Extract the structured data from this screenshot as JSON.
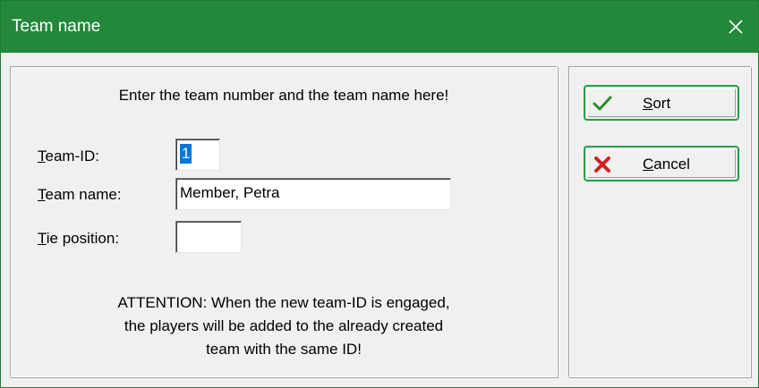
{
  "window": {
    "title": "Team name",
    "close_glyph": "✕",
    "titlebar_color": "#23883a"
  },
  "form": {
    "instruction": "Enter the team number and the team name here!",
    "team_id": {
      "label_first": "T",
      "label_rest": "eam-ID:",
      "value": "1"
    },
    "team_name": {
      "label_first": "T",
      "label_rest": "eam name:",
      "value": "Member, Petra"
    },
    "tie_position": {
      "label_first": "T",
      "label_rest": "ie position:",
      "value": ""
    },
    "attention_lines": [
      "ATTENTION: When the new team-ID is engaged,",
      "the players will be added to the already created",
      "team with the same ID!"
    ]
  },
  "buttons": {
    "sort": {
      "mnemonic": "S",
      "rest": "ort",
      "icon": "checkmark-icon"
    },
    "cancel": {
      "mnemonic": "C",
      "rest": "ancel",
      "icon": "red-x-icon"
    }
  }
}
